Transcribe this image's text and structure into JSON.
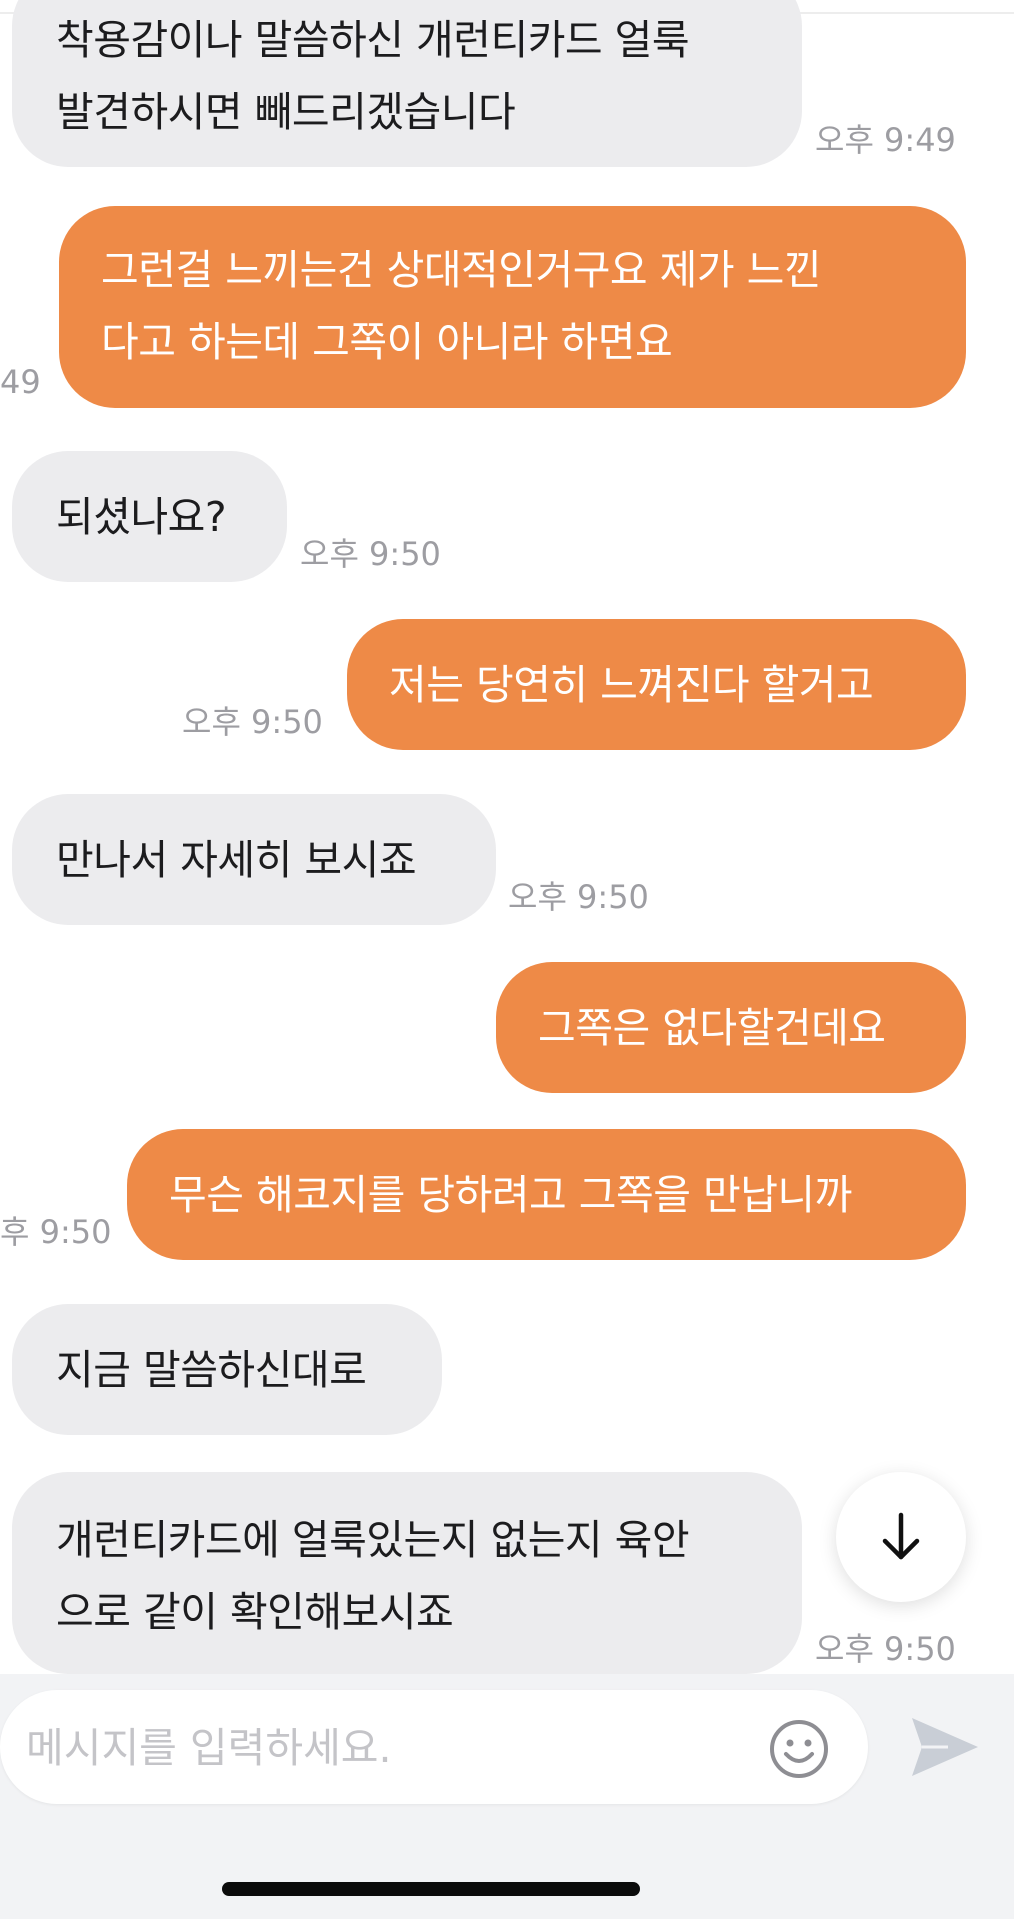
{
  "colors": {
    "outgoing_bubble": "#ee8a47",
    "incoming_bubble": "#ececee",
    "timestamp": "#9d9da2",
    "input_bar_bg": "#f2f3f5"
  },
  "messages": [
    {
      "direction": "in",
      "text": "착용감이나 말씀하신 개런티카드 얼룩\n발견하시면 빼드리겠습니다",
      "time": "오후 9:49"
    },
    {
      "direction": "out",
      "text": "그런걸 느끼는건 상대적인거구요 제가 느낀\n다고 하는데 그쪽이 아니라 하면요",
      "time": "49"
    },
    {
      "direction": "in",
      "text": "되셨나요?",
      "time": "오후 9:50"
    },
    {
      "direction": "out",
      "text": "저는 당연히 느껴진다 할거고",
      "time": "오후 9:50"
    },
    {
      "direction": "in",
      "text": "만나서 자세히 보시죠",
      "time": "오후 9:50"
    },
    {
      "direction": "out",
      "text": "그쪽은 없다할건데요",
      "time": ""
    },
    {
      "direction": "out",
      "text": "무슨 해코지를 당하려고 그쪽을 만납니까",
      "time": "후 9:50"
    },
    {
      "direction": "in",
      "text": "지금 말씀하신대로",
      "time": ""
    },
    {
      "direction": "in",
      "text": "개런티카드에 얼룩있는지 없는지 육안\n으로 같이 확인해보시죠",
      "time": "오후 9:50"
    }
  ],
  "composer": {
    "placeholder": "메시지를 입력하세요.",
    "emoji_icon": "smiley-icon",
    "send_icon": "paper-plane-icon"
  },
  "scroll_button": {
    "icon": "arrow-down-icon"
  }
}
